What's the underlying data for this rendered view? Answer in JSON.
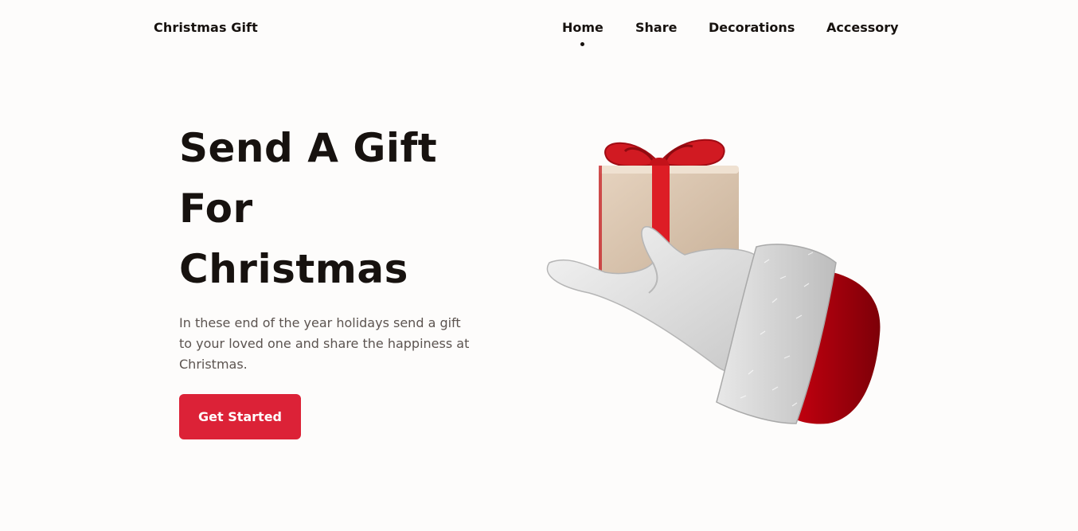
{
  "header": {
    "logo": "Christmas Gift",
    "nav": [
      {
        "label": "Home",
        "active": true
      },
      {
        "label": "Share"
      },
      {
        "label": "Decorations"
      },
      {
        "label": "Accessory"
      }
    ]
  },
  "hero": {
    "title_lines": [
      "Send A Gift",
      "For",
      "Christmas"
    ],
    "description": "In these end of the year holidays send a gift to your loved one and share the happiness at Christmas.",
    "cta_label": "Get Started",
    "illustration": "santa-glove-holding-gift-icon"
  },
  "colors": {
    "accent": "#dc2237",
    "text": "#17120f",
    "muted_text": "#5c5450",
    "background": "#fdfcfb"
  }
}
